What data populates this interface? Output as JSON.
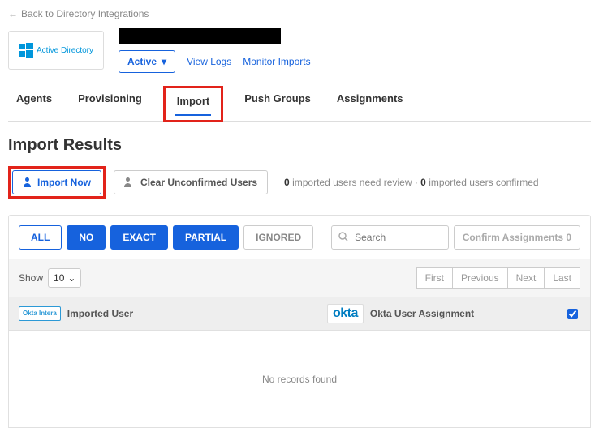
{
  "back_link": "Back to Directory Integrations",
  "app_logo_label": "Active Directory",
  "header": {
    "status_label": "Active",
    "view_logs": "View Logs",
    "monitor_imports": "Monitor Imports"
  },
  "tabs": [
    "Agents",
    "Provisioning",
    "Import",
    "Push Groups",
    "Assignments"
  ],
  "active_tab": "Import",
  "section_title": "Import Results",
  "actions": {
    "import_now": "Import Now",
    "clear_unconfirmed": "Clear Unconfirmed Users"
  },
  "status": {
    "review_count": "0",
    "review_text": "imported users need review",
    "sep": "·",
    "confirmed_count": "0",
    "confirmed_text": "imported users confirmed"
  },
  "filters": {
    "all": "ALL",
    "no": "NO",
    "exact": "EXACT",
    "partial": "PARTIAL",
    "ignored": "IGNORED"
  },
  "search_placeholder": "Search",
  "confirm_btn": "Confirm Assignments 0",
  "table": {
    "show_label": "Show",
    "show_value": "10",
    "pager": {
      "first": "First",
      "prev": "Previous",
      "next": "Next",
      "last": "Last"
    },
    "col_imported": "Imported User",
    "col_okta": "Okta User Assignment",
    "src_badge": "Okta Intera",
    "empty": "No records found"
  }
}
